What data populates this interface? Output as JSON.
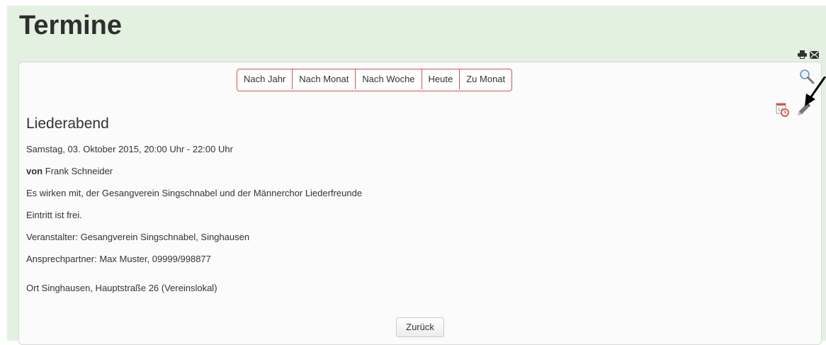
{
  "page": {
    "title": "Termine"
  },
  "toolbar": {
    "print_icon": "print-icon",
    "email_icon": "email-icon"
  },
  "nav": {
    "buttons": [
      "Nach Jahr",
      "Nach Monat",
      "Nach Woche",
      "Heute",
      "Zu Monat"
    ],
    "accent": "#d9534f"
  },
  "actions": {
    "search_icon": "search-icon",
    "calendar_icon": "calendar-icon",
    "edit_icon": "pencil-icon"
  },
  "event": {
    "title": "Liederabend",
    "date": "Samstag, 03. Oktober 2015, 20:00 Uhr - 22:00 Uhr",
    "by_label": "von",
    "by_name": "Frank Schneider",
    "participants": "Es wirken mit, der Gesangverein Singschnabel und der Männerchor Liederfreunde",
    "entry": "Eintritt ist frei.",
    "organizer": "Veranstalter: Gesangverein Singschnabel, Singhausen",
    "contact": "Ansprechpartner: Max Muster, 09999/998877",
    "location": "Ort Singhausen, Hauptstraße 26 (Vereinslokal)"
  },
  "footer": {
    "back_label": "Zurück"
  },
  "colors": {
    "background": "#e3f1e1",
    "panel": "#fbfbfb"
  }
}
